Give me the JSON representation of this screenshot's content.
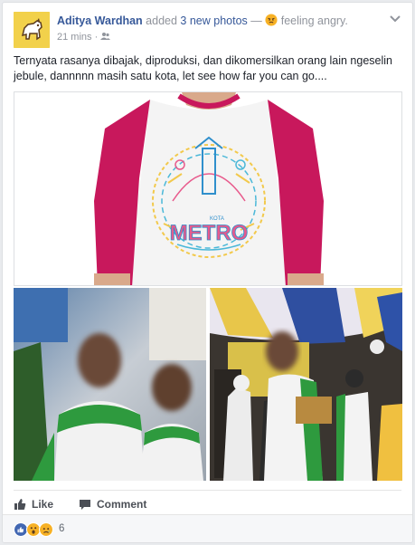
{
  "header": {
    "author": "Aditya Wardhan",
    "action_prefix": "added",
    "action_link": "3 new photos",
    "separator": "—",
    "feeling": "feeling angry.",
    "time": "21 mins",
    "privacy_icon": "friends-icon",
    "menu_icon": "chevron-down-icon"
  },
  "post": {
    "text": "Ternyata rasanya dibajak, diproduksi, dan dikomersilkan orang lain ngeselin jebule, dannnnn masih satu kota, let see how far you can go...."
  },
  "photos": {
    "main_shirt_text": "METRO",
    "main_shirt_small": "KOTA"
  },
  "actions": {
    "like_label": "Like",
    "comment_label": "Comment"
  },
  "reactions": {
    "icons": [
      "like-icon",
      "wow-icon",
      "sad-icon"
    ],
    "count": "6"
  },
  "colors": {
    "link": "#365899",
    "muted": "#90949c",
    "shirt_sleeve": "#c8185c",
    "action_text": "#4b4f56"
  }
}
